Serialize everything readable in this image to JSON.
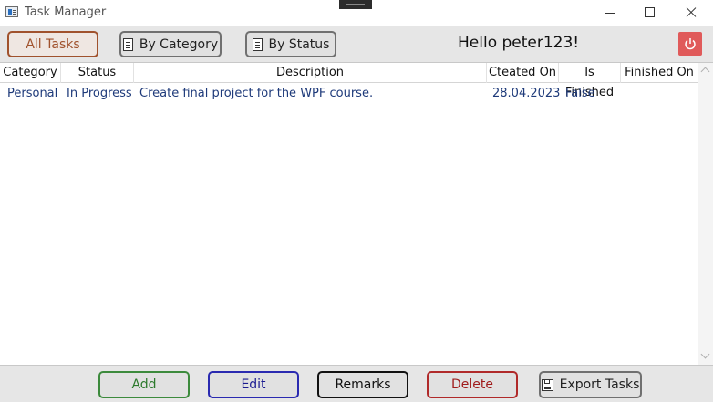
{
  "window": {
    "title": "Task Manager"
  },
  "toolbar": {
    "all_tasks": "All Tasks",
    "by_category": "By Category",
    "by_status": "By Status",
    "greeting": "Hello peter123!"
  },
  "table": {
    "columns": [
      "Category",
      "Status",
      "Description",
      "Cteated On",
      "Is Finished",
      "Finished On"
    ],
    "rows": [
      {
        "category": "Personal",
        "status": "In Progress",
        "description": "Create final project for the WPF course.",
        "created_on": "28.04.2023",
        "is_finished": "False",
        "finished_on": ""
      }
    ]
  },
  "actions": {
    "add": "Add",
    "edit": "Edit",
    "remarks": "Remarks",
    "delete": "Delete",
    "export": "Export Tasks"
  },
  "colors": {
    "all_tasks": "#a0522d",
    "add": "#3c8a3c",
    "edit": "#2a2ab0",
    "delete": "#b02a2a",
    "power": "#e05a5a",
    "cell_text": "#1e3a7a"
  },
  "icons": [
    "app-icon",
    "doc-icon",
    "power-icon",
    "floppy-icon",
    "minimize-icon",
    "maximize-icon",
    "close-icon"
  ]
}
